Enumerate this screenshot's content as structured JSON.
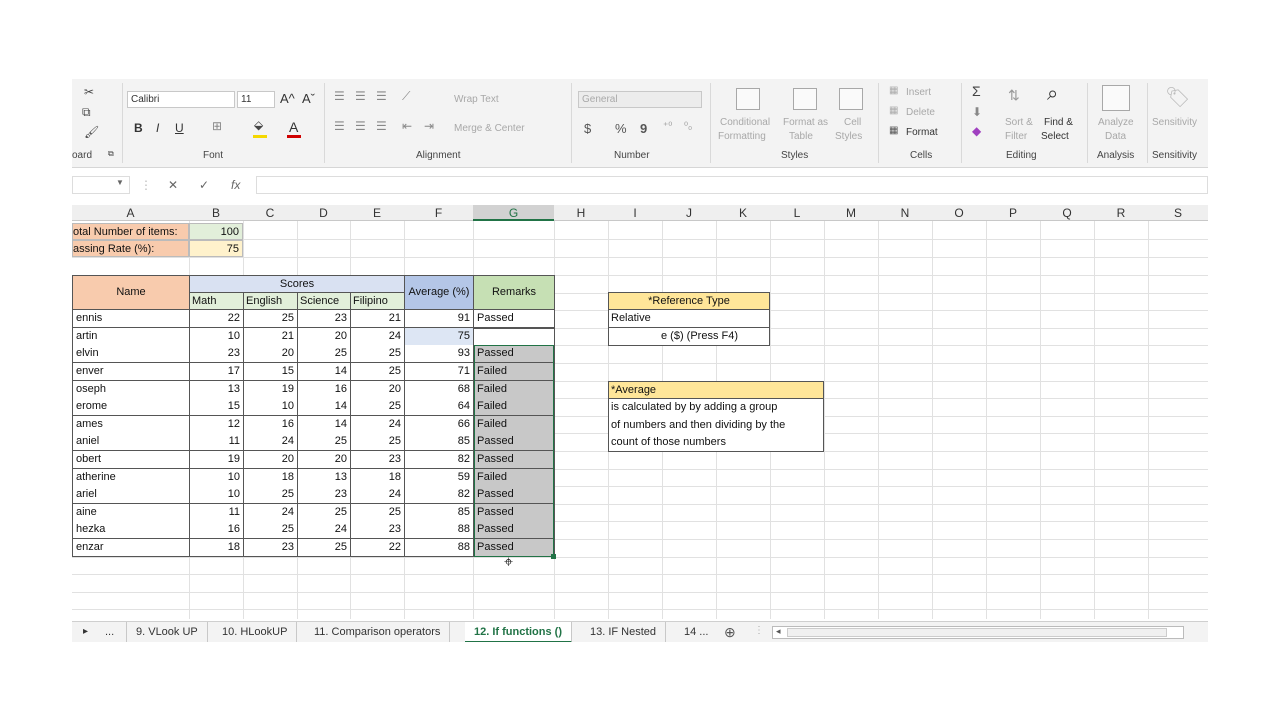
{
  "ribbon": {
    "clipboard": {
      "label": "oard",
      "cut_icon": "scissors-icon",
      "copy_icon": "copy-icon",
      "painter_icon": "format-painter-icon"
    },
    "font": {
      "label": "Font",
      "name": "Calibri",
      "size": "11",
      "grow": "A^",
      "shrink": "Aˇ",
      "bold": "B",
      "italic": "I",
      "underline": "U",
      "font_color_letter": "A",
      "font_color": "#d00000",
      "fill_color": "#f5d800"
    },
    "alignment": {
      "label": "Alignment",
      "wrap_text": "Wrap Text",
      "merge_center": "Merge & Center"
    },
    "number": {
      "label": "Number",
      "format": "General",
      "currency": "$",
      "percent": "%",
      "comma": "9"
    },
    "styles": {
      "label": "Styles",
      "conditional": [
        "Conditional",
        "Formatting"
      ],
      "format_as_table": [
        "Format as",
        "Table"
      ],
      "cell_styles": [
        "Cell",
        "Styles"
      ]
    },
    "cells": {
      "label": "Cells",
      "insert": "Insert",
      "delete": "Delete",
      "format": "Format"
    },
    "editing": {
      "label": "Editing",
      "sort_filter": [
        "Sort &",
        "Filter"
      ],
      "find_select": [
        "Find &",
        "Select"
      ]
    },
    "analysis": {
      "label": "Analysis",
      "analyze": [
        "Analyze",
        "Data"
      ]
    },
    "sensitivity": {
      "label": "Sensitivity",
      "name": "Sensitivity"
    }
  },
  "formula_bar": {
    "cancel": "✕",
    "enter": "✓",
    "fx": "fx",
    "value": ""
  },
  "columns": [
    "A",
    "B",
    "C",
    "D",
    "E",
    "F",
    "G",
    "H",
    "I",
    "J",
    "K",
    "L",
    "M",
    "N",
    "O",
    "P",
    "Q",
    "R",
    "S"
  ],
  "sheet": {
    "total_items_label": "otal Number of items:",
    "total_items_value": "100",
    "passing_rate_label": "assing Rate (%):",
    "passing_rate_value": "75",
    "header_name": "Name",
    "header_scores": "Scores",
    "header_math": "Math",
    "header_english": "English",
    "header_science": "Science",
    "header_filipino": "Filipino",
    "header_average": "Average (%)",
    "header_remarks": "Remarks",
    "rows": [
      {
        "name": "ennis",
        "math": "22",
        "english": "25",
        "science": "23",
        "filipino": "21",
        "average": "91",
        "remarks": "Passed"
      },
      {
        "name": "artin",
        "math": "10",
        "english": "21",
        "science": "20",
        "filipino": "24",
        "average": "75",
        "remarks": ""
      },
      {
        "name": "elvin",
        "math": "23",
        "english": "20",
        "science": "25",
        "filipino": "25",
        "average": "93",
        "remarks": "Passed"
      },
      {
        "name": "enver",
        "math": "17",
        "english": "15",
        "science": "14",
        "filipino": "25",
        "average": "71",
        "remarks": "Failed"
      },
      {
        "name": "oseph",
        "math": "13",
        "english": "19",
        "science": "16",
        "filipino": "20",
        "average": "68",
        "remarks": "Failed"
      },
      {
        "name": "erome",
        "math": "15",
        "english": "10",
        "science": "14",
        "filipino": "25",
        "average": "64",
        "remarks": "Failed"
      },
      {
        "name": "ames",
        "math": "12",
        "english": "16",
        "science": "14",
        "filipino": "24",
        "average": "66",
        "remarks": "Failed"
      },
      {
        "name": "aniel",
        "math": "11",
        "english": "24",
        "science": "25",
        "filipino": "25",
        "average": "85",
        "remarks": "Passed"
      },
      {
        "name": "obert",
        "math": "19",
        "english": "20",
        "science": "20",
        "filipino": "23",
        "average": "82",
        "remarks": "Passed"
      },
      {
        "name": "atherine",
        "math": "10",
        "english": "18",
        "science": "13",
        "filipino": "18",
        "average": "59",
        "remarks": "Failed"
      },
      {
        "name": "ariel",
        "math": "10",
        "english": "25",
        "science": "23",
        "filipino": "24",
        "average": "82",
        "remarks": "Passed"
      },
      {
        "name": "aine",
        "math": "11",
        "english": "24",
        "science": "25",
        "filipino": "25",
        "average": "85",
        "remarks": "Passed"
      },
      {
        "name": "hezka",
        "math": "16",
        "english": "25",
        "science": "24",
        "filipino": "23",
        "average": "88",
        "remarks": "Passed"
      },
      {
        "name": "enzar",
        "math": "18",
        "english": "23",
        "science": "25",
        "filipino": "22",
        "average": "88",
        "remarks": "Passed"
      }
    ],
    "ref_type_title": "*Reference Type",
    "ref_type_line1": "Relative",
    "ref_type_line2": "e ($) (Press F4)",
    "avg_title": "*Average",
    "avg_line1": "is calculated by by adding a group",
    "avg_line2": "of numbers and then dividing by the",
    "avg_line3": "count of those numbers"
  },
  "tabs": {
    "nav_next": "▸",
    "nav_more": "...",
    "items": [
      "9. VLook UP",
      "10. HLookUP",
      "11. Comparison operators",
      "12. If functions ()",
      "13. IF Nested",
      "14 ..."
    ],
    "active_index": 3,
    "add": "⊕"
  },
  "colors": {
    "accent": "#217346",
    "name_fill": "#f8cbad",
    "scores_fill": "#d9e1f2",
    "average_fill": "#d9e1f2",
    "remarks_fill": "#c6e0b4",
    "selection_fill": "#c8c8c8",
    "note_fill": "#ffe699"
  }
}
